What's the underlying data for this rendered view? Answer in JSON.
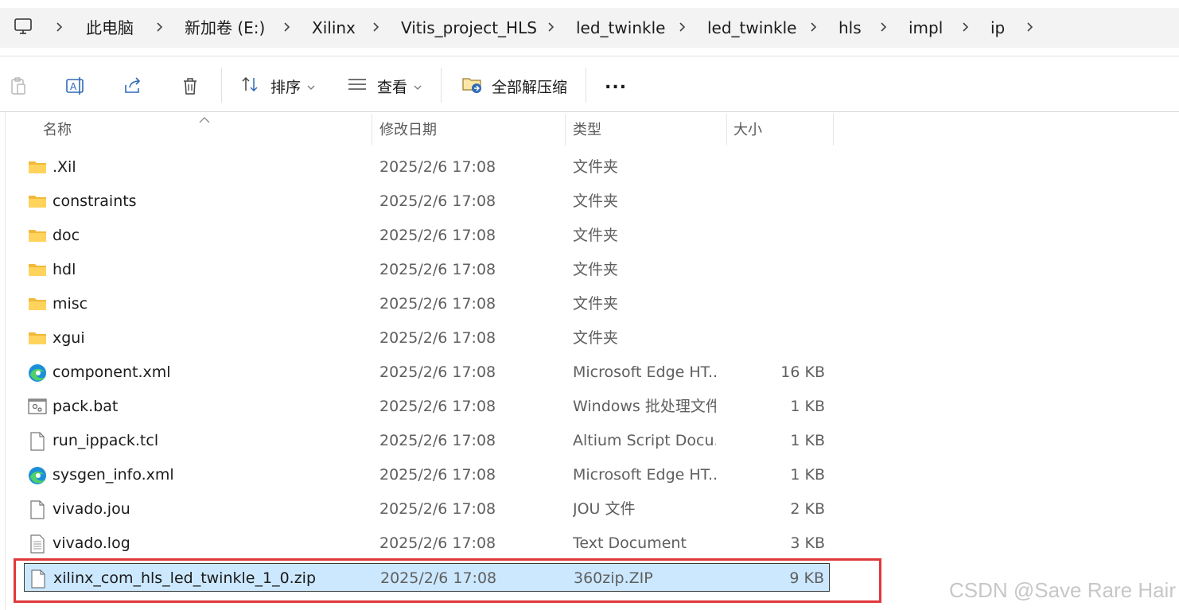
{
  "address": {
    "crumbs": [
      "此电脑",
      "新加卷 (E:)",
      "Xilinx",
      "Vitis_project_HLS",
      "led_twinkle",
      "led_twinkle",
      "hls",
      "impl",
      "ip"
    ]
  },
  "toolbar": {
    "sort_label": "排序",
    "view_label": "查看",
    "extract_label": "全部解压缩",
    "more_label": "..."
  },
  "columns": {
    "name": "名称",
    "date": "修改日期",
    "type": "类型",
    "size": "大小"
  },
  "files": [
    {
      "name": ".Xil",
      "date": "2025/2/6 17:08",
      "type": "文件夹",
      "size": "",
      "icon": "folder-icon"
    },
    {
      "name": "constraints",
      "date": "2025/2/6 17:08",
      "type": "文件夹",
      "size": "",
      "icon": "folder-icon"
    },
    {
      "name": "doc",
      "date": "2025/2/6 17:08",
      "type": "文件夹",
      "size": "",
      "icon": "folder-icon"
    },
    {
      "name": "hdl",
      "date": "2025/2/6 17:08",
      "type": "文件夹",
      "size": "",
      "icon": "folder-icon"
    },
    {
      "name": "misc",
      "date": "2025/2/6 17:08",
      "type": "文件夹",
      "size": "",
      "icon": "folder-icon"
    },
    {
      "name": "xgui",
      "date": "2025/2/6 17:08",
      "type": "文件夹",
      "size": "",
      "icon": "folder-icon"
    },
    {
      "name": "component.xml",
      "date": "2025/2/6 17:08",
      "type": "Microsoft Edge HT...",
      "size": "16 KB",
      "icon": "edge-icon"
    },
    {
      "name": "pack.bat",
      "date": "2025/2/6 17:08",
      "type": "Windows 批处理文件",
      "size": "1 KB",
      "icon": "batch-file-icon"
    },
    {
      "name": "run_ippack.tcl",
      "date": "2025/2/6 17:08",
      "type": "Altium Script Docu...",
      "size": "1 KB",
      "icon": "file-icon"
    },
    {
      "name": "sysgen_info.xml",
      "date": "2025/2/6 17:08",
      "type": "Microsoft Edge HT...",
      "size": "1 KB",
      "icon": "edge-icon"
    },
    {
      "name": "vivado.jou",
      "date": "2025/2/6 17:08",
      "type": "JOU 文件",
      "size": "2 KB",
      "icon": "file-icon"
    },
    {
      "name": "vivado.log",
      "date": "2025/2/6 17:08",
      "type": "Text Document",
      "size": "3 KB",
      "icon": "text-file-icon"
    },
    {
      "name": "xilinx_com_hls_led_twinkle_1_0.zip",
      "date": "2025/2/6 17:08",
      "type": "360zip.ZIP",
      "size": "9 KB",
      "icon": "file-icon",
      "selected": true
    }
  ],
  "watermark": "CSDN @Save Rare Hair",
  "colors": {
    "selection": "#cce8ff",
    "highlight_border": "#e0393b",
    "folder": "#f4c542"
  }
}
